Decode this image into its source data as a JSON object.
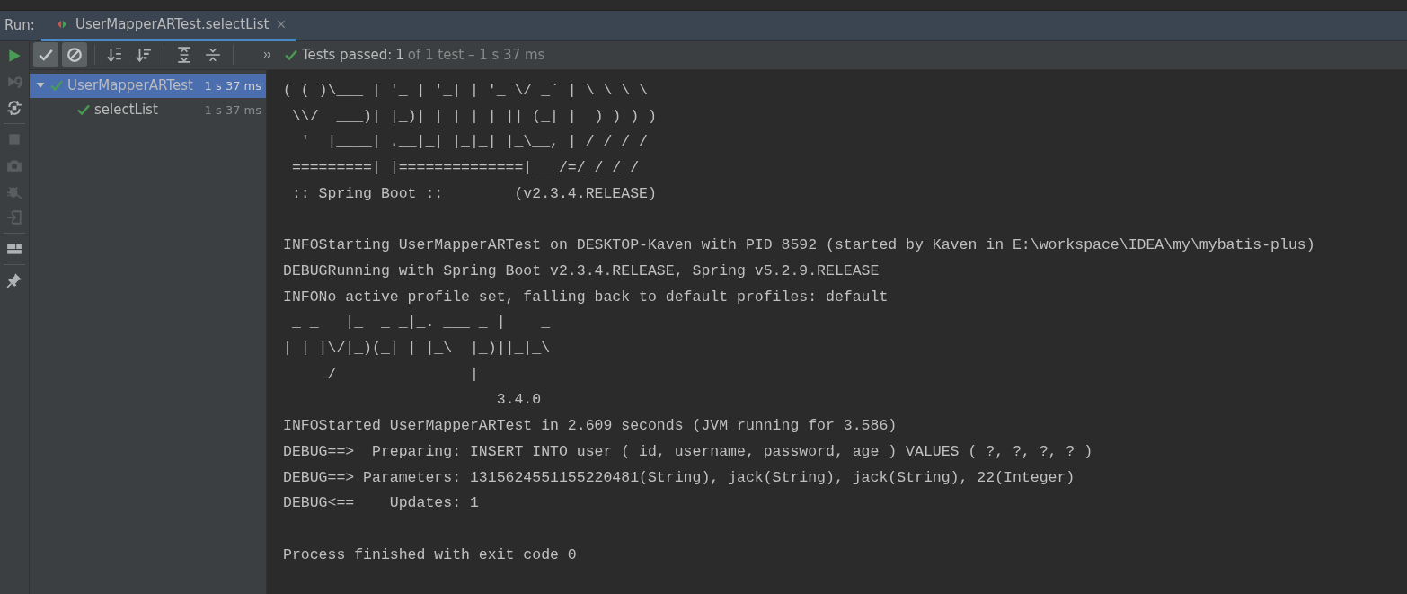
{
  "run_label": "Run:",
  "tabs": [
    {
      "title": "UserMapperARTest.selectList",
      "selected": true
    }
  ],
  "side_tools": [
    {
      "kind": "run",
      "disabled": false
    },
    {
      "kind": "rerun-failed",
      "disabled": true
    },
    {
      "kind": "toggle-auto",
      "disabled": false
    },
    {
      "kind": "stop",
      "disabled": true
    },
    {
      "kind": "camera",
      "disabled": true
    },
    {
      "kind": "bug",
      "disabled": true
    },
    {
      "kind": "export",
      "disabled": true
    },
    {
      "kind": "layout",
      "disabled": false
    },
    {
      "kind": "pin",
      "disabled": false
    }
  ],
  "toolbar": {
    "filters": [
      {
        "kind": "passed",
        "on": true
      },
      {
        "kind": "ignored",
        "on": true
      }
    ],
    "status": {
      "label": "Tests passed:",
      "count": "1",
      "detail": "of 1 test – 1 s 37 ms"
    }
  },
  "tree": [
    {
      "name": "UserMapperARTest",
      "time": "1 s 37 ms",
      "selected": true,
      "expanded": true,
      "children": [
        {
          "name": "selectList",
          "time": "1 s 37 ms",
          "selected": false
        }
      ]
    }
  ],
  "console": {
    "blocks": [
      {
        "lines": [
          "( ( )\\___ | '_ | '_| | '_ \\/ _` | \\ \\ \\ \\",
          " \\\\/  ___)| |_)| | | | | || (_| |  ) ) ) )",
          "  '  |____| .__|_| |_|_| |_\\__, | / / / /",
          " =========|_|==============|___/=/_/_/_/",
          " :: Spring Boot ::        (v2.3.4.RELEASE)"
        ]
      },
      {
        "lines": [
          "INFOStarting UserMapperARTest on DESKTOP-Kaven with PID 8592 (started by Kaven in E:\\workspace\\IDEA\\my\\mybatis-plus)",
          "DEBUGRunning with Spring Boot v2.3.4.RELEASE, Spring v5.2.9.RELEASE",
          "INFONo active profile set, falling back to default profiles: default",
          " _ _   |_  _ _|_. ___ _ |    _",
          "| | |\\/|_)(_| | |_\\  |_)||_|_\\",
          "     /               |",
          "                        3.4.0",
          "INFOStarted UserMapperARTest in 2.609 seconds (JVM running for 3.586)",
          "DEBUG==>  Preparing: INSERT INTO user ( id, username, password, age ) VALUES ( ?, ?, ?, ? )",
          "DEBUG==> Parameters: 1315624551155220481(String), jack(String), jack(String), 22(Integer)",
          "DEBUG<==    Updates: 1"
        ]
      },
      {
        "lines": [
          "Process finished with exit code 0"
        ]
      }
    ]
  }
}
